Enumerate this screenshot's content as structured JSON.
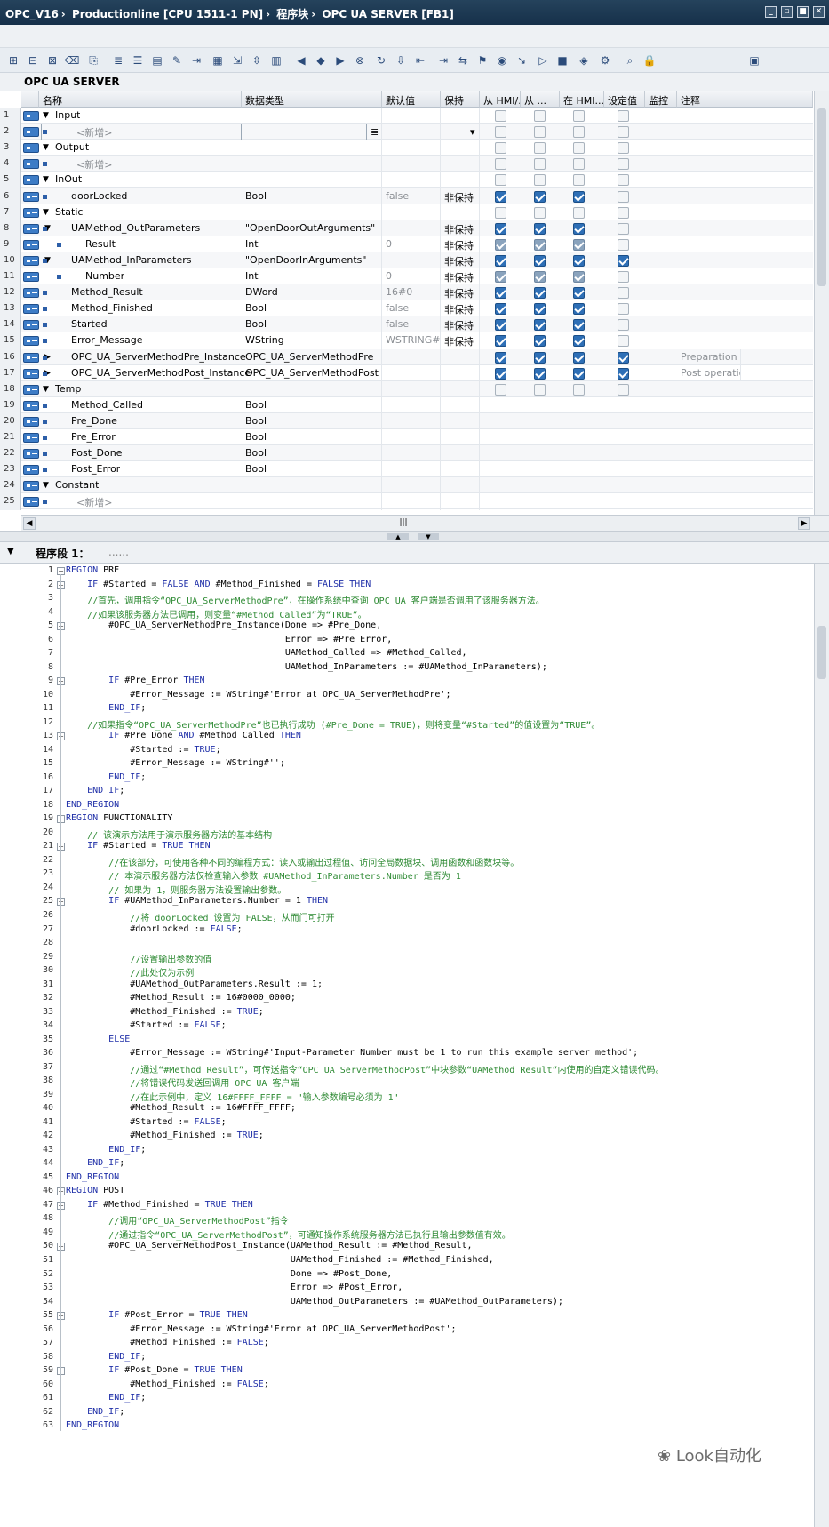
{
  "breadcrumb": [
    "OPC_V16",
    "Productionline [CPU 1511-1 PN]",
    "程序块",
    "OPC UA SERVER [FB1]"
  ],
  "block_title": "OPC UA SERVER",
  "columns": [
    "名称",
    "数据类型",
    "默认值",
    "保持",
    "从 HMI/...",
    "从 ...",
    "在 HMI...",
    "设定值",
    "监控",
    "注释"
  ],
  "rows": [
    {
      "n": "1",
      "level": 0,
      "tri": "down",
      "name": "Input",
      "type": "",
      "def": "",
      "ret": "",
      "c": [
        0,
        0,
        0,
        0
      ]
    },
    {
      "n": "2",
      "level": 1,
      "tri": "",
      "name": "<新增>",
      "type": "",
      "def": "",
      "ret": "",
      "c": [
        0,
        0,
        0,
        0
      ],
      "add": true,
      "sel": true
    },
    {
      "n": "3",
      "level": 0,
      "tri": "down",
      "name": "Output",
      "type": "",
      "def": "",
      "ret": "",
      "c": [
        0,
        0,
        0,
        0
      ]
    },
    {
      "n": "4",
      "level": 1,
      "tri": "",
      "name": "<新增>",
      "type": "",
      "def": "",
      "ret": "",
      "c": [
        0,
        0,
        0,
        0
      ],
      "add": true
    },
    {
      "n": "5",
      "level": 0,
      "tri": "down",
      "name": "InOut",
      "type": "",
      "def": "",
      "ret": "",
      "c": [
        0,
        0,
        0,
        0
      ]
    },
    {
      "n": "6",
      "level": 1,
      "tri": "",
      "name": "doorLocked",
      "type": "Bool",
      "def": "false",
      "ret": "非保持",
      "c": [
        1,
        1,
        1,
        0
      ]
    },
    {
      "n": "7",
      "level": 0,
      "tri": "down",
      "name": "Static",
      "type": "",
      "def": "",
      "ret": "",
      "c": [
        0,
        0,
        0,
        0
      ]
    },
    {
      "n": "8",
      "level": 1,
      "tri": "down",
      "name": "UAMethod_OutParameters",
      "type": "\"OpenDoorOutArguments\"",
      "def": "",
      "ret": "非保持",
      "c": [
        1,
        1,
        1,
        0
      ]
    },
    {
      "n": "9",
      "level": 2,
      "tri": "",
      "name": "Result",
      "type": "Int",
      "def": "0",
      "ret": "非保持",
      "c": [
        2,
        2,
        2,
        0
      ]
    },
    {
      "n": "10",
      "level": 1,
      "tri": "down",
      "name": "UAMethod_InParameters",
      "type": "\"OpenDoorInArguments\"",
      "def": "",
      "ret": "非保持",
      "c": [
        1,
        1,
        1,
        1
      ]
    },
    {
      "n": "11",
      "level": 2,
      "tri": "",
      "name": "Number",
      "type": "Int",
      "def": "0",
      "ret": "非保持",
      "c": [
        2,
        2,
        2,
        0
      ]
    },
    {
      "n": "12",
      "level": 1,
      "tri": "",
      "name": "Method_Result",
      "type": "DWord",
      "def": "16#0",
      "ret": "非保持",
      "c": [
        1,
        1,
        1,
        0
      ]
    },
    {
      "n": "13",
      "level": 1,
      "tri": "",
      "name": "Method_Finished",
      "type": "Bool",
      "def": "false",
      "ret": "非保持",
      "c": [
        1,
        1,
        1,
        0
      ]
    },
    {
      "n": "14",
      "level": 1,
      "tri": "",
      "name": "Started",
      "type": "Bool",
      "def": "false",
      "ret": "非保持",
      "c": [
        1,
        1,
        1,
        0
      ]
    },
    {
      "n": "15",
      "level": 1,
      "tri": "",
      "name": "Error_Message",
      "type": "WString",
      "def": "WSTRING#''",
      "ret": "非保持",
      "c": [
        1,
        1,
        1,
        0
      ]
    },
    {
      "n": "16",
      "level": 1,
      "tri": "right",
      "name": "OPC_UA_ServerMethodPre_Instance",
      "type": "OPC_UA_ServerMethodPre",
      "def": "",
      "ret": "",
      "c": [
        1,
        1,
        1,
        1
      ],
      "cm": "Preparation fo"
    },
    {
      "n": "17",
      "level": 1,
      "tri": "right",
      "name": "OPC_UA_ServerMethodPost_Instance",
      "type": "OPC_UA_ServerMethodPost",
      "def": "",
      "ret": "",
      "c": [
        1,
        1,
        1,
        1
      ],
      "cm": "Post operation"
    },
    {
      "n": "18",
      "level": 0,
      "tri": "down",
      "name": "Temp",
      "type": "",
      "def": "",
      "ret": "",
      "c": [
        0,
        0,
        0,
        0
      ]
    },
    {
      "n": "19",
      "level": 1,
      "tri": "",
      "name": "Method_Called",
      "type": "Bool",
      "def": "",
      "ret": "",
      "c": []
    },
    {
      "n": "20",
      "level": 1,
      "tri": "",
      "name": "Pre_Done",
      "type": "Bool",
      "def": "",
      "ret": "",
      "c": []
    },
    {
      "n": "21",
      "level": 1,
      "tri": "",
      "name": "Pre_Error",
      "type": "Bool",
      "def": "",
      "ret": "",
      "c": []
    },
    {
      "n": "22",
      "level": 1,
      "tri": "",
      "name": "Post_Done",
      "type": "Bool",
      "def": "",
      "ret": "",
      "c": []
    },
    {
      "n": "23",
      "level": 1,
      "tri": "",
      "name": "Post_Error",
      "type": "Bool",
      "def": "",
      "ret": "",
      "c": []
    },
    {
      "n": "24",
      "level": 0,
      "tri": "down",
      "name": "Constant",
      "type": "",
      "def": "",
      "ret": "",
      "c": []
    },
    {
      "n": "25",
      "level": 1,
      "tri": "",
      "name": "<新增>",
      "type": "",
      "def": "",
      "ret": "",
      "c": [],
      "add": true
    }
  ],
  "segment": "程序段 1：",
  "segment_comment": "......",
  "code": [
    "REGION PRE",
    "    IF #Started = FALSE AND #Method_Finished = FALSE THEN",
    "    //首先，调用指令“OPC_UA_ServerMethodPre”，在操作系统中查询 OPC UA 客户端是否调用了该服务器方法。",
    "    //如果该服务器方法已调用，则变量“#Method_Called”为“TRUE”。",
    "        #OPC_UA_ServerMethodPre_Instance(Done => #Pre_Done,",
    "                                         Error => #Pre_Error,",
    "                                         UAMethod_Called => #Method_Called,",
    "                                         UAMethod_InParameters := #UAMethod_InParameters);",
    "        IF #Pre_Error THEN",
    "            #Error_Message := WString#'Error at OPC_UA_ServerMethodPre';",
    "        END_IF;",
    "    //如果指令“OPC_UA_ServerMethodPre”也已执行成功 (#Pre_Done = TRUE)，则将变量“#Started”的值设置为“TRUE”。",
    "        IF #Pre_Done AND #Method_Called THEN",
    "            #Started := TRUE;",
    "            #Error_Message := WString#'';",
    "        END_IF;",
    "    END_IF;",
    "END_REGION",
    "REGION FUNCTIONALITY",
    "    // 该演示方法用于演示服务器方法的基本结构",
    "    IF #Started = TRUE THEN",
    "        //在该部分，可使用各种不同的编程方式：读入或输出过程值、访问全局数据块、调用函数和函数块等。",
    "        // 本演示服务器方法仅检查输入参数 #UAMethod_InParameters.Number 是否为 1",
    "        // 如果为 1，则服务器方法设置输出参数。",
    "        IF #UAMethod_InParameters.Number = 1 THEN",
    "            //将 doorLocked 设置为 FALSE，从而门可打开",
    "            #doorLocked := FALSE;",
    "",
    "            //设置输出参数的值",
    "            //此处仅为示例",
    "            #UAMethod_OutParameters.Result := 1;",
    "            #Method_Result := 16#0000_0000;",
    "            #Method_Finished := TRUE;",
    "            #Started := FALSE;",
    "        ELSE",
    "            #Error_Message := WString#'Input-Parameter Number must be 1 to run this example server method';",
    "            //通过“#Method_Result”，可传送指令“OPC_UA_ServerMethodPost”中块参数“UAMethod_Result”内使用的自定义错误代码。",
    "            //将错误代码发送回调用 OPC UA 客户端",
    "            //在此示例中，定义 16#FFFF_FFFF = \"输入参数编号必须为 1\"",
    "            #Method_Result := 16#FFFF_FFFF;",
    "            #Started := FALSE;",
    "            #Method_Finished := TRUE;",
    "        END_IF;",
    "    END_IF;",
    "END_REGION",
    "REGION POST",
    "    IF #Method_Finished = TRUE THEN",
    "        //调用“OPC_UA_ServerMethodPost”指令",
    "        //通过指令“OPC_UA_ServerMethodPost”，可通知操作系统服务器方法已执行且输出参数值有效。",
    "        #OPC_UA_ServerMethodPost_Instance(UAMethod_Result := #Method_Result,",
    "                                          UAMethod_Finished := #Method_Finished,",
    "                                          Done => #Post_Done,",
    "                                          Error => #Post_Error,",
    "                                          UAMethod_OutParameters := #UAMethod_OutParameters);",
    "        IF #Post_Error = TRUE THEN",
    "            #Error_Message := WString#'Error at OPC_UA_ServerMethodPost';",
    "            #Method_Finished := FALSE;",
    "        END_IF;",
    "        IF #Post_Done = TRUE THEN",
    "            #Method_Finished := FALSE;",
    "        END_IF;",
    "    END_IF;",
    "END_REGION"
  ],
  "folds": [
    1,
    2,
    5,
    9,
    13,
    19,
    21,
    25,
    46,
    47,
    50,
    55,
    59
  ],
  "watermark": "Look自动化",
  "colors": {
    "accent": "#2e6fb6",
    "keyword": "#1f2fa8",
    "comment": "#2d8a33"
  }
}
